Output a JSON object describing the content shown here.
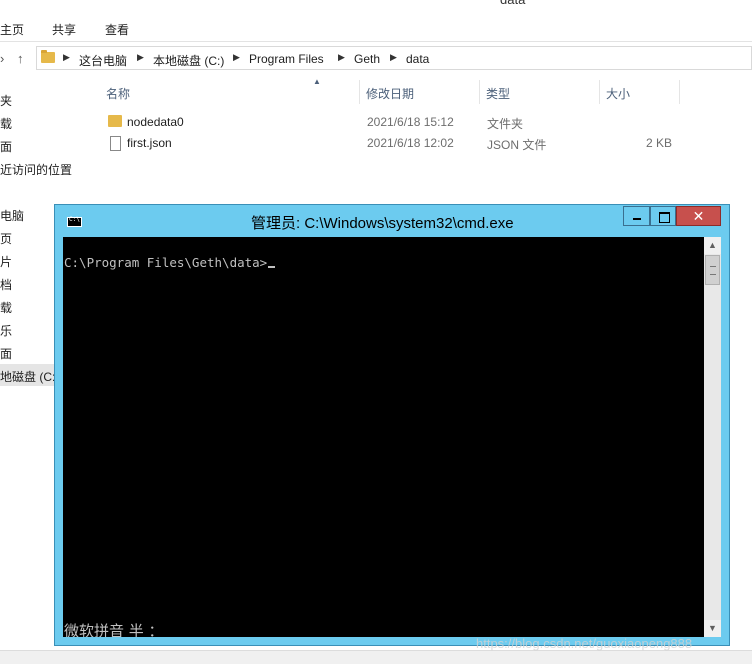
{
  "explorer": {
    "window_title": "data",
    "ribbon_tabs": [
      "主页",
      "共享",
      "查看"
    ],
    "breadcrumb": [
      "这台电脑",
      "本地磁盘 (C:)",
      "Program Files",
      "Geth",
      "data"
    ],
    "nav_items": [
      "夹",
      "载",
      "面",
      "近访问的位置",
      "电脑",
      "页",
      "片",
      "档",
      "载",
      "乐",
      "面",
      "地磁盘 (C:)"
    ],
    "columns": [
      "名称",
      "修改日期",
      "类型",
      "大小"
    ],
    "files": [
      {
        "name": "nodedata0",
        "modified": "2021/6/18 15:12",
        "type": "文件夹",
        "size": "",
        "icon": "folder-icon"
      },
      {
        "name": "first.json",
        "modified": "2021/6/18 12:02",
        "type": "JSON 文件",
        "size": "2 KB",
        "icon": "file-icon"
      }
    ]
  },
  "cmd": {
    "title": "管理员: C:\\Windows\\system32\\cmd.exe",
    "prompt": "C:\\Program Files\\Geth\\data>",
    "ime_status": "微软拼音 半 ：",
    "close_label": "✕"
  },
  "watermark": "https://blog.csdn.net/guoxiaopeng888",
  "colors": {
    "cmd_frame": "#6ccbef",
    "close_button": "#c7504d",
    "console_bg": "#000000",
    "console_text": "#c0c0c0"
  }
}
